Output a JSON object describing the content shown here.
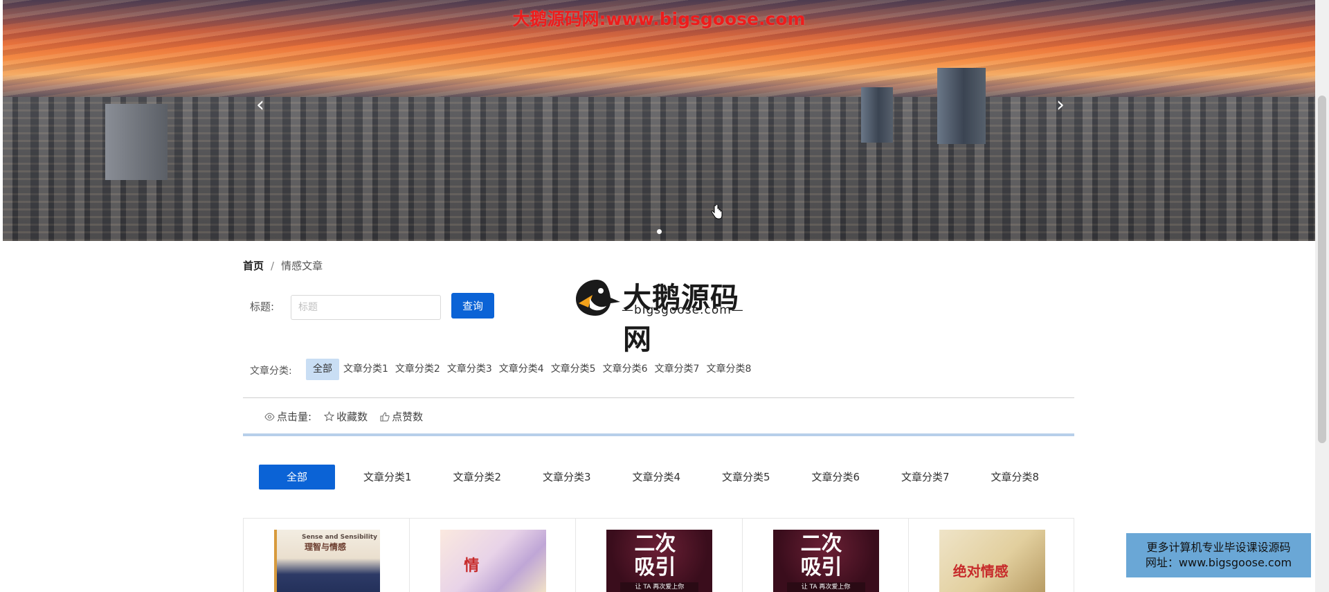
{
  "banner": {
    "watermark": "大鹅源码网:www.bigsgoose.com",
    "prev_icon": "chevron-left-icon",
    "next_icon": "chevron-right-icon"
  },
  "breadcrumb": {
    "home": "首页",
    "separator": "/",
    "current": "情感文章"
  },
  "search": {
    "label": "标题:",
    "placeholder": "标题",
    "value": "",
    "button": "查询"
  },
  "logo": {
    "title": "大鹅源码网",
    "subtitle": "—bigsgoose.com—"
  },
  "category_filter": {
    "label": "文章分类:",
    "options": [
      "全部",
      "文章分类1",
      "文章分类2",
      "文章分类3",
      "文章分类4",
      "文章分类5",
      "文章分类6",
      "文章分类7",
      "文章分类8"
    ],
    "selected": "全部"
  },
  "sort": {
    "views": "点击量:",
    "favorites": "收藏数",
    "likes": "点赞数"
  },
  "tabs": {
    "items": [
      "全部",
      "文章分类1",
      "文章分类2",
      "文章分类3",
      "文章分类4",
      "文章分类5",
      "文章分类6",
      "文章分类7",
      "文章分类8"
    ],
    "selected": "全部"
  },
  "cards": [
    {
      "cover_title": "理智与情感",
      "cover_small": "Sense and Sensibility"
    },
    {
      "cover_title": "情"
    },
    {
      "cover_title": "二次吸引",
      "cover_ribbon": "让 TA 再次爱上你"
    },
    {
      "cover_title": "二次吸引",
      "cover_ribbon": "让 TA 再次爱上你"
    },
    {
      "cover_title": "绝对情感"
    }
  ],
  "promo": {
    "line1": "更多计算机专业毕设课设源码",
    "line2": "网址：www.bigsgoose.com"
  },
  "colors": {
    "primary": "#0b63d6",
    "active_filter_bg": "#c9def4",
    "watermark": "#ee1c1c",
    "promo_bg": "#6aa7d6",
    "divider_accent": "#b7cfea"
  }
}
